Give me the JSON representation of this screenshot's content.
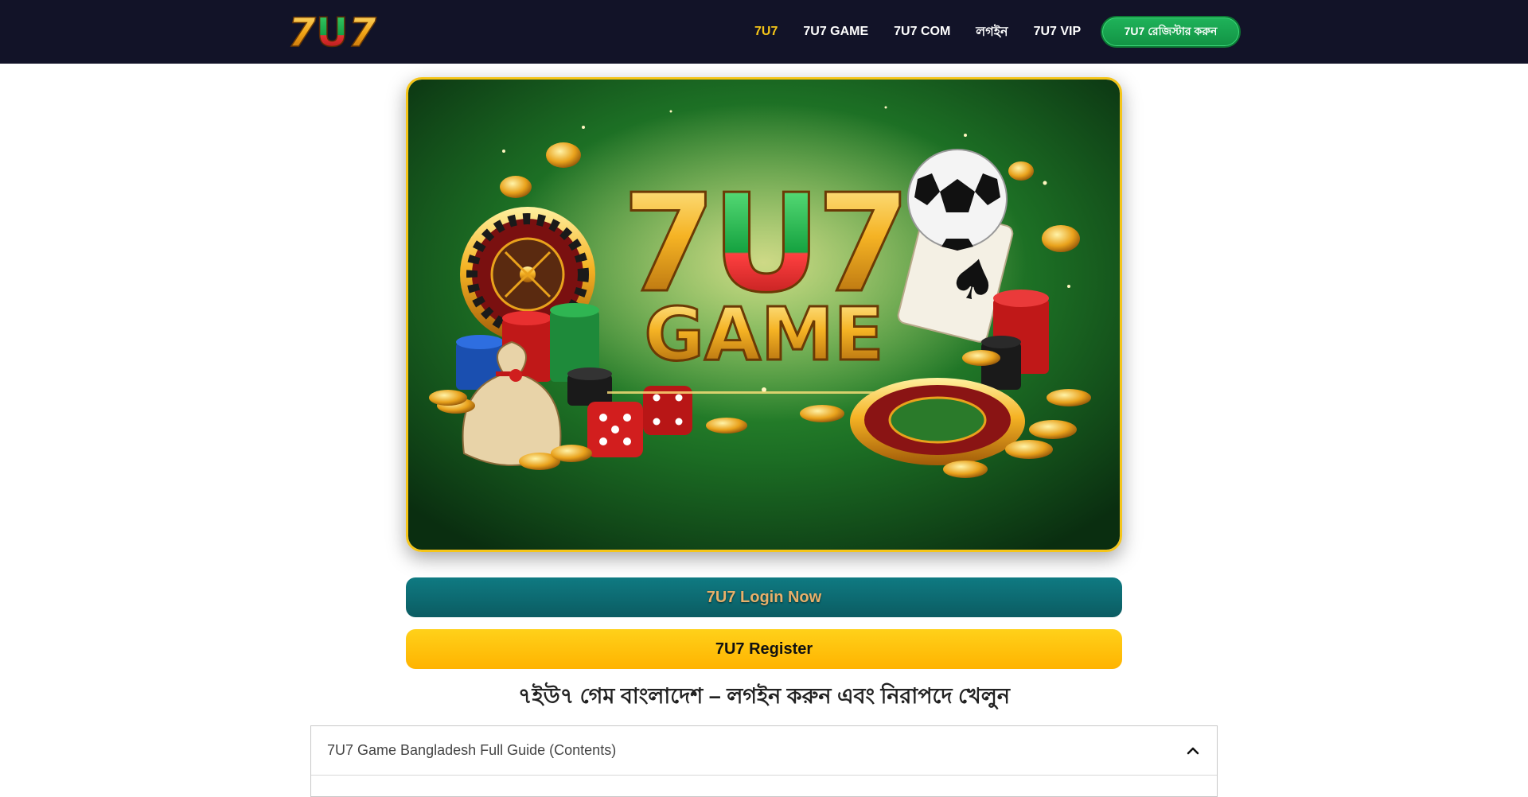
{
  "header": {
    "logo_text": "7U7",
    "nav": [
      {
        "label": "7U7",
        "active": true
      },
      {
        "label": "7U7 GAME",
        "active": false
      },
      {
        "label": "7U7 COM",
        "active": false
      },
      {
        "label": "লগইন",
        "active": false
      },
      {
        "label": "7U7 VIP",
        "active": false
      }
    ],
    "cta_label": "7U7 রেজিস্টার করুন",
    "accent_color": "#f5c518",
    "background_color": "#121328"
  },
  "hero": {
    "banner_title": "7U7",
    "banner_subtitle": "GAME",
    "border_color": "#f5c518",
    "icons": [
      "roulette-wheel-icon",
      "poker-chips-icon",
      "money-bag-icon",
      "dice-icon",
      "playing-cards-icon",
      "soccer-ball-icon",
      "gold-coins-icon"
    ]
  },
  "actions": {
    "login_label": "7U7 Login Now",
    "register_label": "7U7 Register"
  },
  "main": {
    "heading": "৭ইউ৭ গেম বাংলাদেশ – লগইন করুন এবং নিরাপদে খেলুন"
  },
  "toc": {
    "title": "7U7 Game Bangladesh Full Guide (Contents)",
    "expanded": true
  }
}
